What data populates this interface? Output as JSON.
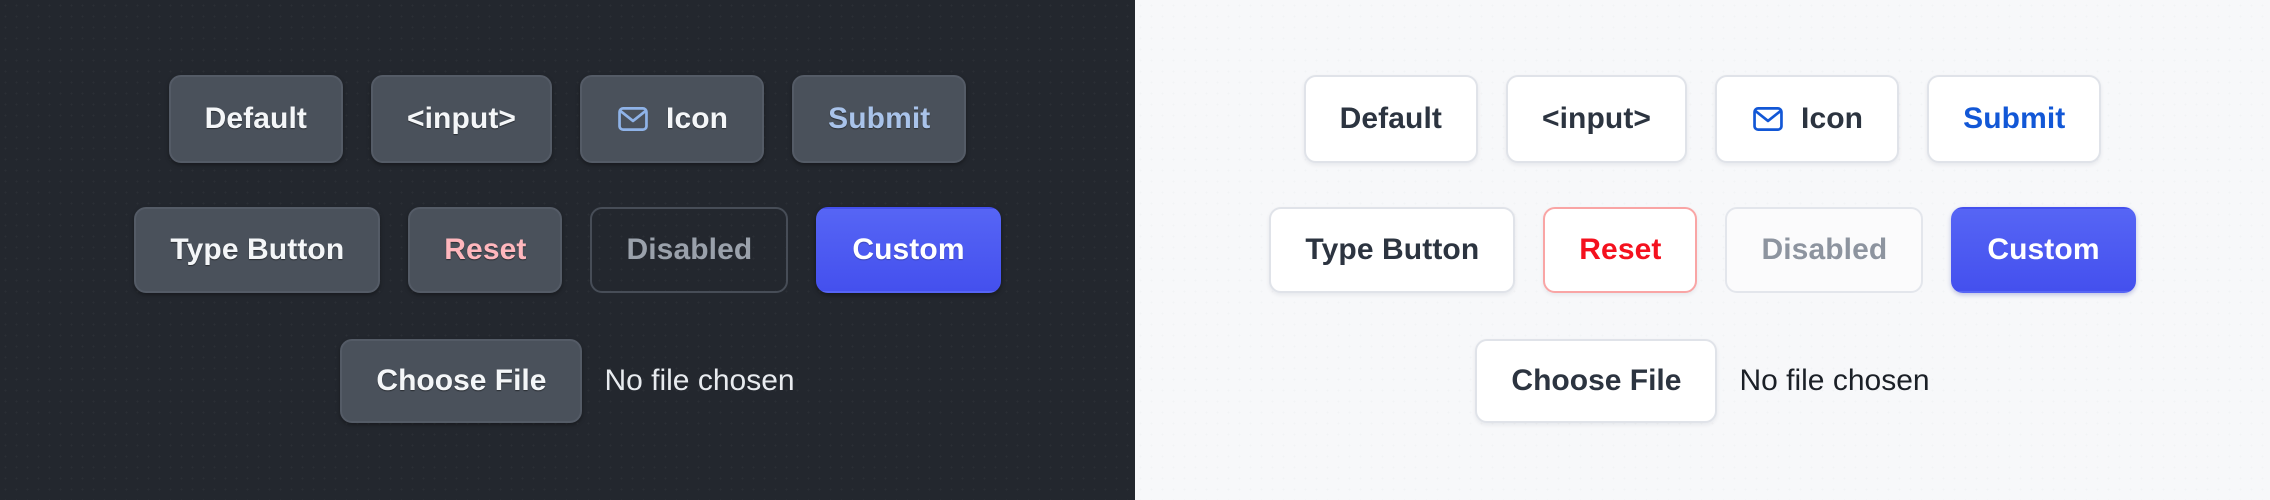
{
  "panels": [
    {
      "theme": "dark",
      "background": "#23272e",
      "rows": [
        {
          "buttons": [
            {
              "label": "Default",
              "kind": "solid"
            },
            {
              "label": "<input>",
              "kind": "solid"
            },
            {
              "label": "Icon",
              "kind": "solid",
              "icon": "mail-icon",
              "icon_color": "#8fb3e8"
            },
            {
              "label": "Submit",
              "kind": "solid-accent",
              "text_color": "#a9c3ea"
            }
          ]
        },
        {
          "buttons": [
            {
              "label": "Type Button",
              "kind": "solid"
            },
            {
              "label": "Reset",
              "kind": "solid-danger",
              "text_color": "#ffb7bd"
            },
            {
              "label": "Disabled",
              "kind": "disabled"
            },
            {
              "label": "Custom",
              "kind": "custom",
              "background": "#4c59f2"
            }
          ]
        }
      ],
      "file_input": {
        "button_label": "Choose File",
        "status_text": "No file chosen"
      }
    },
    {
      "theme": "light",
      "background": "#f7f8fa",
      "rows": [
        {
          "buttons": [
            {
              "label": "Default",
              "kind": "solid"
            },
            {
              "label": "<input>",
              "kind": "solid"
            },
            {
              "label": "Icon",
              "kind": "solid",
              "icon": "mail-icon",
              "icon_color": "#1257d6"
            },
            {
              "label": "Submit",
              "kind": "solid-accent",
              "text_color": "#1257d6"
            }
          ]
        },
        {
          "buttons": [
            {
              "label": "Type Button",
              "kind": "solid"
            },
            {
              "label": "Reset",
              "kind": "danger-outline",
              "text_color": "#f4111e",
              "border_color": "#f9a5a5"
            },
            {
              "label": "Disabled",
              "kind": "disabled"
            },
            {
              "label": "Custom",
              "kind": "custom",
              "background": "#4c59f2"
            }
          ]
        }
      ],
      "file_input": {
        "button_label": "Choose File",
        "status_text": "No file chosen"
      }
    }
  ]
}
